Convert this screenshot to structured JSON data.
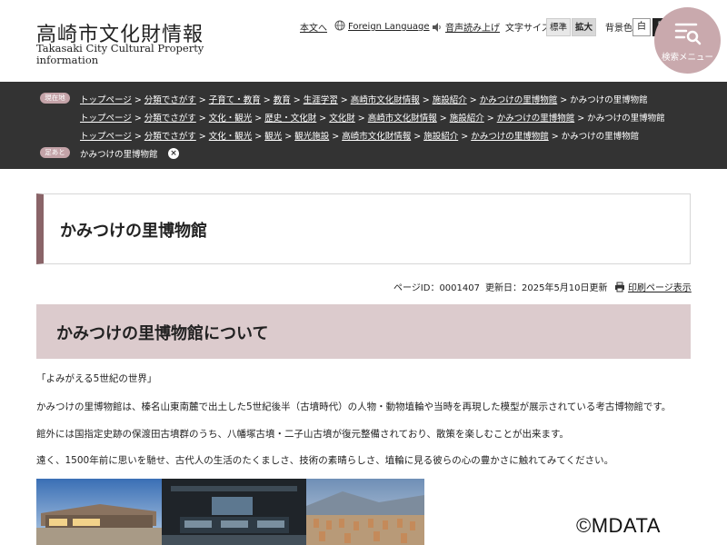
{
  "site": {
    "title_ja": "高崎市文化財情報",
    "title_en": "Takasaki City Cultural Property information"
  },
  "utility": {
    "skip_to_content": "本文へ",
    "foreign_language": "Foreign Language",
    "read_aloud": "音声読み上げ",
    "font_size_label": "文字サイズ",
    "font_size_standard": "標準",
    "font_size_large": "拡大",
    "bg_color_label": "背景色",
    "bg_white": "白",
    "bg_black": "黒",
    "search_menu": "検索メニュー"
  },
  "breadcrumbs": {
    "current_tag": "現在地",
    "lines": [
      [
        "トップページ",
        "分類でさがす",
        "子育て・教育",
        "教育",
        "生涯学習",
        "高崎市文化財情報",
        "施設紹介",
        "かみつけの里博物館",
        "かみつけの里博物館"
      ],
      [
        "トップページ",
        "分類でさがす",
        "文化・観光",
        "歴史・文化財",
        "文化財",
        "高崎市文化財情報",
        "施設紹介",
        "かみつけの里博物館",
        "かみつけの里博物館"
      ],
      [
        "トップページ",
        "分類でさがす",
        "文化・観光",
        "観光",
        "観光施設",
        "高崎市文化財情報",
        "施設紹介",
        "かみつけの里博物館",
        "かみつけの里博物館"
      ]
    ],
    "footprint_tag": "足あと",
    "footprint_item": "かみつけの里博物館"
  },
  "page": {
    "title": "かみつけの里博物館",
    "page_id": "ページID：0001407",
    "updated": "更新日：2025年5月10日更新",
    "print": "印刷ページ表示",
    "section_heading": "かみつけの里博物館について",
    "paragraphs": [
      "「よみがえる5世紀の世界」",
      "かみつけの里博物館は、榛名山東南麓で出土した5世紀後半（古墳時代）の人物・動物埴輪や当時を再現した模型が展示されている考古博物館です。",
      "館外には国指定史跡の保渡田古墳群のうち、八幡塚古墳・二子山古墳が復元整備されており、散策を楽しむことが出来ます。",
      "遠く、1500年前に思いを馳せ、古代人の生活のたくましさ、技術の素晴らしさ、埴輪に見る彼らの心の豊かさに触れてみてください。"
    ]
  },
  "watermark": "©MDATA",
  "colors": {
    "accent": "#8a6468",
    "section_band": "#dccbcd",
    "breadcrumb_bg": "#333333",
    "search_menu_bg": "#c9a9ad"
  }
}
